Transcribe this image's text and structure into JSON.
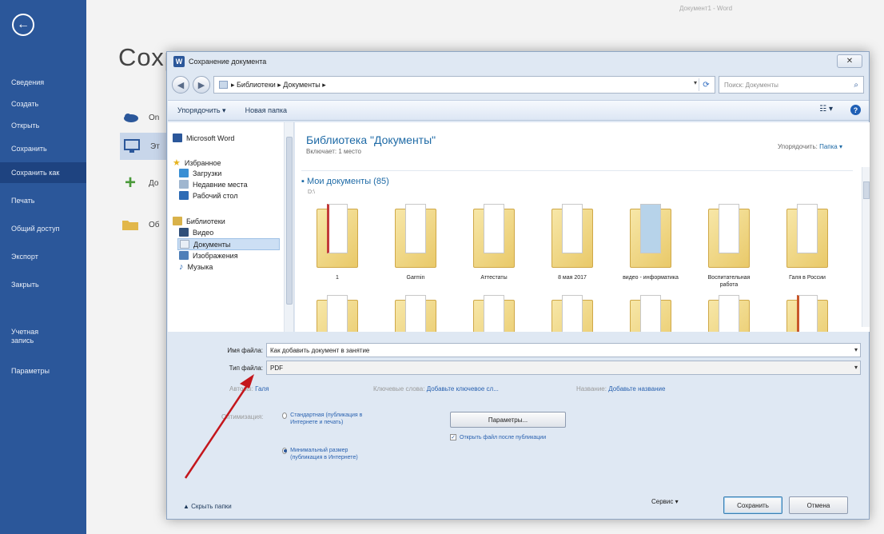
{
  "sidebar": {
    "items": [
      {
        "label": "Сведения",
        "y": 0
      },
      {
        "label": "Создать"
      },
      {
        "label": "Открыть"
      },
      {
        "label": "Сохранить"
      },
      {
        "label": "Сохранить как"
      },
      {
        "label": "Печать"
      },
      {
        "label": "Общий доступ"
      },
      {
        "label": "Экспорт"
      },
      {
        "label": "Закрыть"
      },
      {
        "label": "Учетная запись"
      },
      {
        "label": "Параметры"
      }
    ]
  },
  "window": {
    "title": "Документ1 - Word"
  },
  "backstage": {
    "heading": "Сохр",
    "options": [
      {
        "label": "On"
      },
      {
        "label": "Эт"
      },
      {
        "label": "До"
      },
      {
        "label": "Об"
      }
    ]
  },
  "dialog": {
    "title": "Сохранение документа",
    "close_symbol": "✕",
    "address": {
      "path": "▸ Библиотеки ▸ Документы ▸"
    },
    "search": {
      "placeholder": "Поиск: Документы"
    },
    "toolbar": {
      "organize": "Упорядочить ▾",
      "new_folder": "Новая папка"
    },
    "navpane": {
      "items": [
        {
          "label": "Microsoft Word"
        },
        {
          "label": "Избранное"
        },
        {
          "label": "Загрузки"
        },
        {
          "label": "Недавние места"
        },
        {
          "label": "Рабочий стол"
        },
        {
          "label": "Библиотеки"
        },
        {
          "label": "Видео"
        },
        {
          "label": "Документы"
        },
        {
          "label": "Изображения"
        },
        {
          "label": "Музыка"
        }
      ]
    },
    "library": {
      "title": "Библиотека \"Документы\"",
      "subtitle": "Включает: 1 место",
      "arrange_label": "Упорядочить:",
      "arrange_value": "Папка ▾",
      "group_title": "▪ Мои документы (85)",
      "group_sub": "D:\\",
      "folders": [
        {
          "name": "1"
        },
        {
          "name": "Garmin"
        },
        {
          "name": "Аттестаты"
        },
        {
          "name": "8 мая 2017"
        },
        {
          "name": "видео - информатика"
        },
        {
          "name": "Воспитательная работа"
        },
        {
          "name": "Галя в России"
        }
      ]
    },
    "form": {
      "filename_label": "Имя файла:",
      "filename_value": "Как добавить документ в занятие",
      "filetype_label": "Тип файла:",
      "filetype_value": "PDF",
      "authors_label": "Авторы:",
      "authors_value": "Галя",
      "keywords_label": "Ключевые слова:",
      "keywords_value": "Добавьте ключевое сл...",
      "title_label": "Название:",
      "title_value": "Добавьте название",
      "optimize_label": "Оптимизация:",
      "radio_standard": "Стандартная (публикация в Интернете и печать)",
      "radio_minimal": "Минимальный размер (публикация в Интернете)",
      "params_button": "Параметры...",
      "open_after": "Открыть файл после публикации"
    },
    "footer": {
      "hide_folders": "▲ Скрыть папки",
      "service": "Сервис ▾",
      "save": "Сохранить",
      "cancel": "Отмена"
    }
  }
}
